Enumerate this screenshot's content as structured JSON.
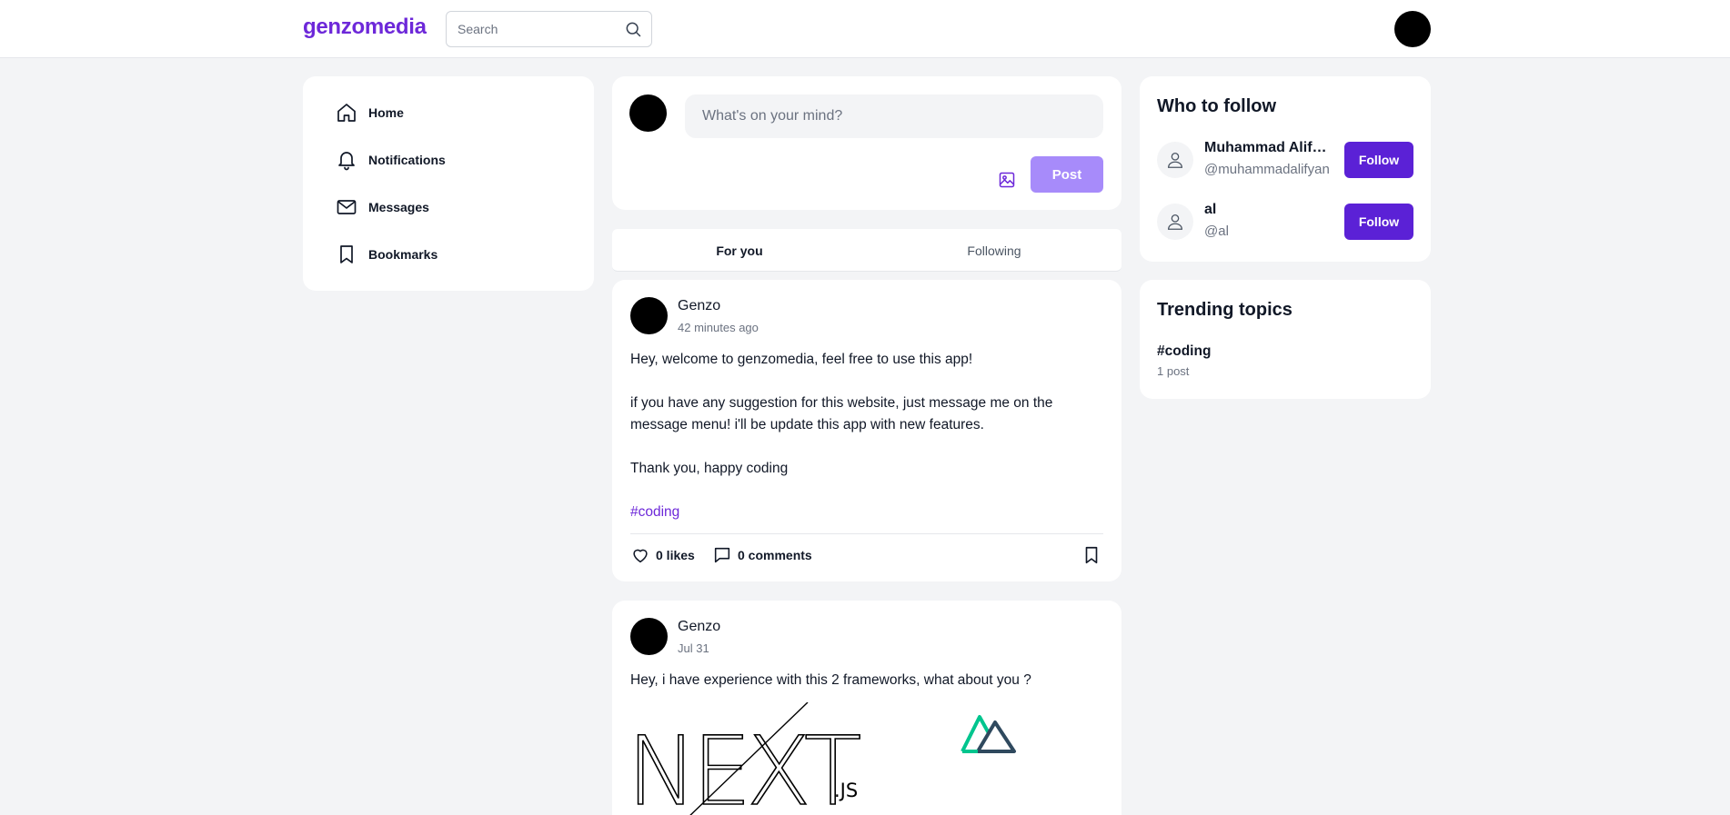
{
  "header": {
    "brand": "genzomedia",
    "search_placeholder": "Search"
  },
  "sidebar": {
    "items": [
      {
        "label": "Home",
        "icon": "home-icon"
      },
      {
        "label": "Notifications",
        "icon": "bell-icon"
      },
      {
        "label": "Messages",
        "icon": "mail-icon"
      },
      {
        "label": "Bookmarks",
        "icon": "bookmark-icon"
      }
    ]
  },
  "composer": {
    "placeholder": "What's on your mind?",
    "post_label": "Post"
  },
  "tabs": [
    {
      "label": "For you",
      "active": true
    },
    {
      "label": "Following",
      "active": false
    }
  ],
  "posts": [
    {
      "author": "Genzo",
      "time": "42 minutes ago",
      "paragraphs": [
        "Hey, welcome to genzomedia, feel free to use this app!",
        "",
        "if you have any suggestion for this website, just message me on the message menu! i'll be update this app with new features.",
        "",
        "Thank you, happy coding",
        ""
      ],
      "hashtag": "#coding",
      "likes": "0 likes",
      "comments": "0 comments"
    },
    {
      "author": "Genzo",
      "time": "Jul 31",
      "paragraphs": [
        "Hey, i have experience with this 2 frameworks, what about you ?"
      ],
      "image_texts": [
        "NEXT",
        ".JS"
      ]
    }
  ],
  "who_to_follow": {
    "title": "Who to follow",
    "users": [
      {
        "name": "Muhammad Alifyan",
        "handle": "@muhammadalifyan",
        "button": "Follow"
      },
      {
        "name": "al",
        "handle": "@al",
        "button": "Follow"
      }
    ]
  },
  "trending": {
    "title": "Trending topics",
    "topics": [
      {
        "tag": "#coding",
        "count": "1 post"
      }
    ]
  },
  "colors": {
    "brand": "#6d28d9",
    "follow_button": "#5b21d6",
    "post_button_disabled": "#a78bfa",
    "page_background": "#f3f4f6"
  }
}
